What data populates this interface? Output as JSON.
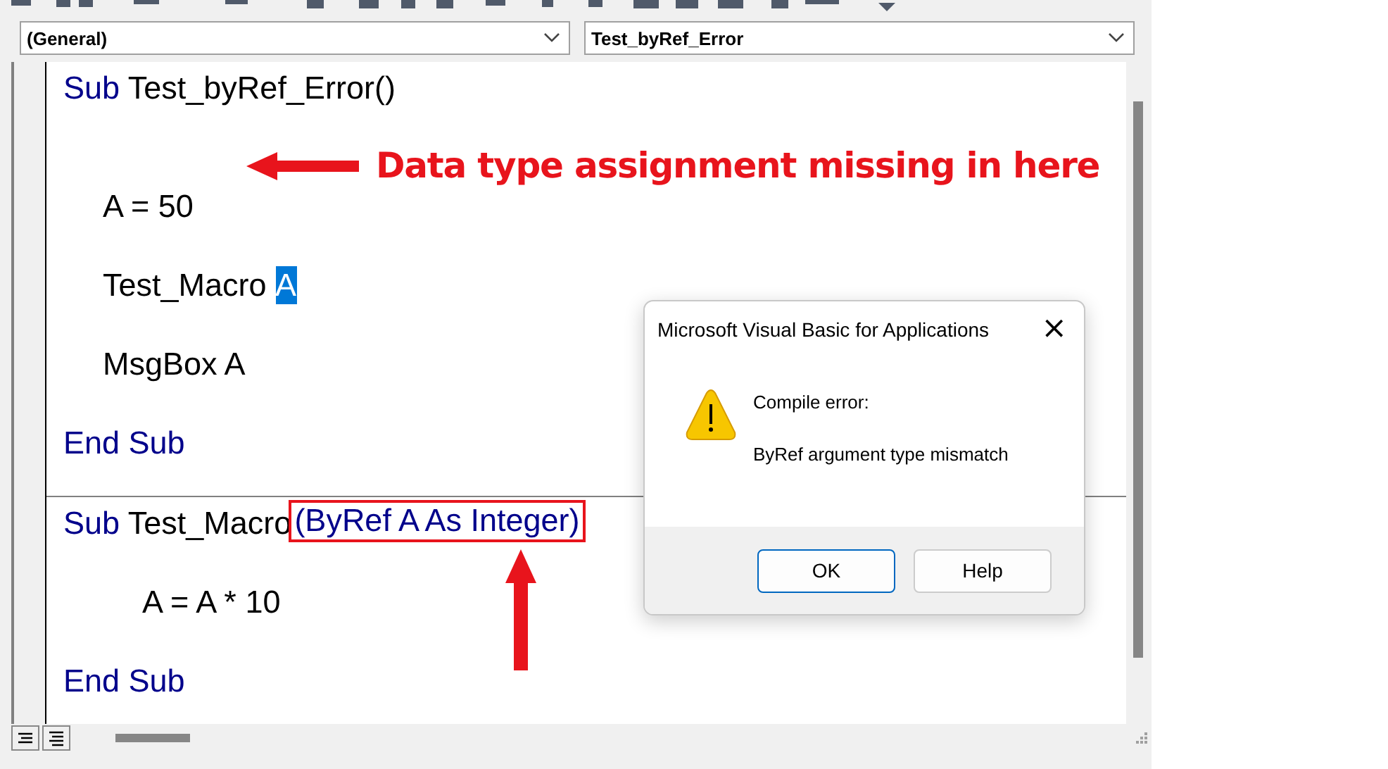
{
  "object_box": {
    "value": "(General)"
  },
  "procedure_box": {
    "value": "Test_byRef_Error"
  },
  "procedures": [
    {
      "lines": [
        {
          "kind": "header",
          "tokens": [
            {
              "text": "Sub",
              "kind": "keyword"
            },
            {
              "text": " Test_byRef_Error()",
              "kind": "plain"
            }
          ]
        },
        {
          "kind": "blank"
        },
        {
          "kind": "body",
          "tokens": [
            {
              "text": "A = 50",
              "kind": "plain"
            }
          ]
        },
        {
          "kind": "body",
          "tokens": [
            {
              "text": "Test_Macro ",
              "kind": "plain"
            },
            {
              "text": "A",
              "kind": "selected"
            }
          ]
        },
        {
          "kind": "body",
          "tokens": [
            {
              "text": "MsgBox A",
              "kind": "plain"
            }
          ]
        },
        {
          "kind": "header",
          "tokens": [
            {
              "text": "End Sub",
              "kind": "keyword"
            }
          ]
        }
      ]
    },
    {
      "lines": [
        {
          "kind": "header",
          "tokens": [
            {
              "text": "Sub",
              "kind": "keyword"
            },
            {
              "text": " Test_Macro",
              "kind": "plain"
            },
            {
              "text": "(ByRef A As Integer)",
              "kind": "boxed"
            }
          ]
        },
        {
          "kind": "nested",
          "tokens": [
            {
              "text": "A = A * 10",
              "kind": "plain"
            }
          ]
        },
        {
          "kind": "header",
          "tokens": [
            {
              "text": "End Sub",
              "kind": "keyword"
            }
          ]
        }
      ]
    }
  ],
  "annotation": {
    "text": "Data type assignment missing in here"
  },
  "dialog": {
    "title": "Microsoft Visual Basic for Applications",
    "close": "×",
    "heading": "Compile error:",
    "message": "ByRef argument type mismatch",
    "buttons": [
      {
        "label": "OK",
        "selected": true
      },
      {
        "label": "Help",
        "selected": false
      }
    ]
  }
}
